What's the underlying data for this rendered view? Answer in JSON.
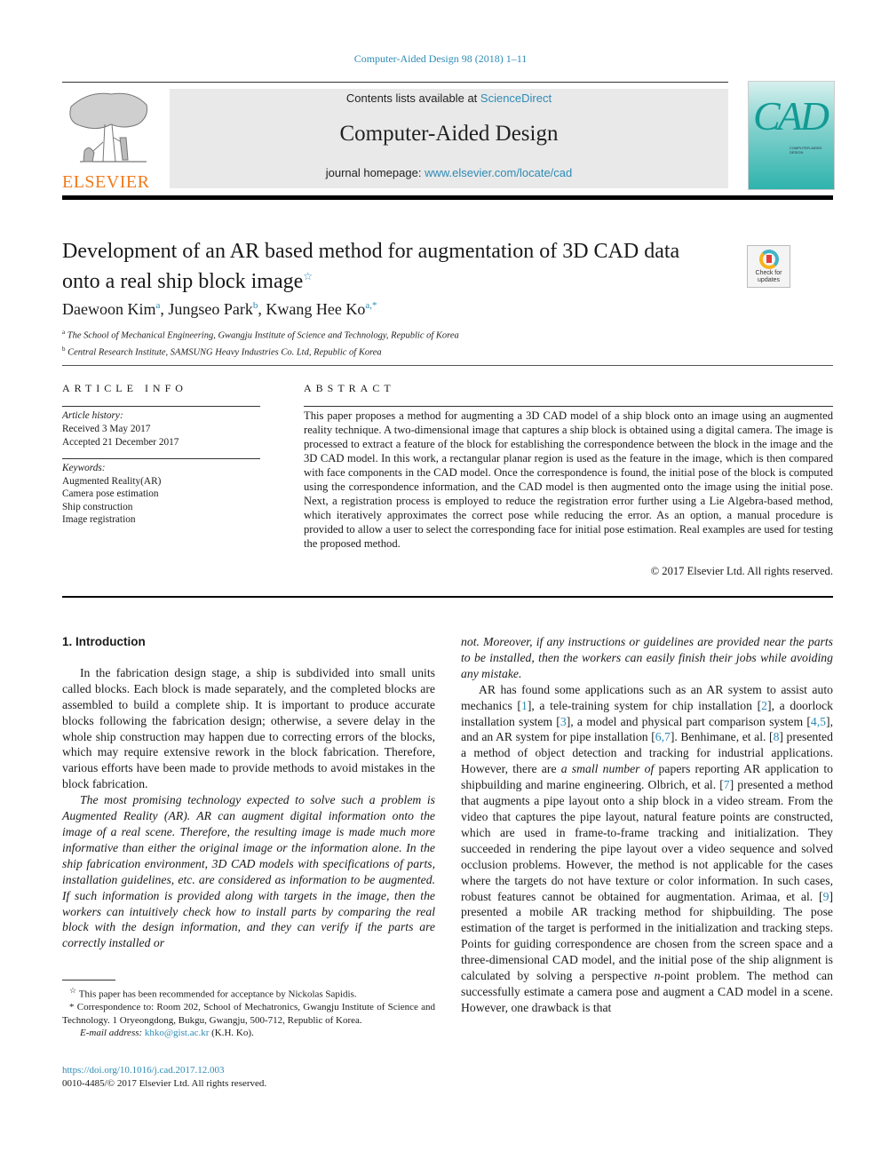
{
  "running_header": "Computer-Aided Design 98 (2018) 1–11",
  "masthead": {
    "publisher_logo": "ELSEVIER",
    "contents_prefix": "Contents lists available at ",
    "contents_link": "ScienceDirect",
    "journal_name": "Computer-Aided Design",
    "homepage_prefix": "journal homepage: ",
    "homepage_link": "www.elsevier.com/locate/cad",
    "cover_title": "CAD",
    "cover_subtitle": "COMPUTER-AIDED DESIGN"
  },
  "article": {
    "title": "Development of an AR based method for augmentation of 3D CAD data onto a real ship block image",
    "title_mark": "☆",
    "check_updates": "Check for updates",
    "authors": [
      {
        "name": "Daewoon Kim",
        "sup": "a",
        "sep": ", "
      },
      {
        "name": "Jungseo Park",
        "sup": "b",
        "sep": ", "
      },
      {
        "name": "Kwang Hee Ko",
        "sup": "a,*",
        "sep": ""
      }
    ],
    "affiliations": [
      {
        "sup": "a",
        "text": "The School of Mechanical Engineering, Gwangju Institute of Science and Technology, Republic of Korea"
      },
      {
        "sup": "b",
        "text": "Central Research Institute, SAMSUNG Heavy Industries Co. Ltd, Republic of Korea"
      }
    ]
  },
  "article_info": {
    "heading": "ARTICLE INFO",
    "history_label": "Article history:",
    "received": "Received 3 May 2017",
    "accepted": "Accepted 21 December 2017",
    "keywords_label": "Keywords:",
    "keywords": [
      "Augmented Reality(AR)",
      "Camera pose estimation",
      "Ship construction",
      "Image registration"
    ]
  },
  "abstract": {
    "heading": "ABSTRACT",
    "text": "This paper proposes a method for augmenting a 3D CAD model of a ship block onto an image using an augmented reality technique. A two-dimensional image that captures a ship block is obtained using a digital camera. The image is processed to extract a feature of the block for establishing the correspondence between the block in the image and the 3D CAD model. In this work, a rectangular planar region is used as the feature in the image, which is then compared with face components in the CAD model. Once the correspondence is found, the initial pose of the block is computed using the correspondence information, and the CAD model is then augmented onto the image using the initial pose. Next, a registration process is employed to reduce the registration error further using a Lie Algebra-based method, which iteratively approximates the correct pose while reducing the error. As an option, a manual procedure is provided to allow a user to select the corresponding face for initial pose estimation. Real examples are used for testing the proposed method.",
    "copyright": "© 2017 Elsevier Ltd. All rights reserved."
  },
  "body": {
    "section_heading": "1.  Introduction",
    "para1": "In the fabrication design stage, a ship is subdivided into small units called blocks. Each block is made separately, and the completed blocks are assembled to build a complete ship. It is important to produce accurate blocks following the fabrication design; otherwise, a severe delay in the whole ship construction may happen due to correcting errors of the blocks, which may require extensive rework in the block fabrication. Therefore, various efforts have been made to provide methods to avoid mistakes in the block fabrication.",
    "para2_left": "The most promising technology expected to solve such a problem is Augmented Reality (AR). AR can augment digital information onto the image of a real scene. Therefore, the resulting image is made much more informative than either the original image or the information alone. In the ship fabrication environment, 3D CAD models with specifications of parts, installation guidelines, etc. are considered as information to be augmented. If such information is provided along with targets in the image, then the workers can intuitively check how to install parts by comparing the real block with the design information, and they can verify if the parts are correctly installed or",
    "para2_right": "not. Moreover, if any instructions or guidelines are provided near the parts to be installed, then the workers can easily finish their jobs while avoiding any mistake.",
    "para3": [
      {
        "t": "AR has found some applications such as an AR system to assist auto mechanics ["
      },
      {
        "c": "1"
      },
      {
        "t": "], a tele-training system for chip installation ["
      },
      {
        "c": "2"
      },
      {
        "t": "], a doorlock installation system ["
      },
      {
        "c": "3"
      },
      {
        "t": "], a model and physical part comparison system ["
      },
      {
        "c": "4,5"
      },
      {
        "t": "], and an AR system for pipe installation ["
      },
      {
        "c": "6,7"
      },
      {
        "t": "]. Benhimane, et al. ["
      },
      {
        "c": "8"
      },
      {
        "t": "] presented a method of object detection and tracking for industrial applications. However, there are "
      },
      {
        "i": "a small number of"
      },
      {
        "t": " papers reporting AR application to shipbuilding and marine engineering. Olbrich, et al. ["
      },
      {
        "c": "7"
      },
      {
        "t": "] presented a method that augments a pipe layout onto a ship block in a video stream. From the video that captures the pipe layout, natural feature points are constructed, which are used in frame-to-frame tracking and initialization. They succeeded in rendering the pipe layout over a video sequence and solved occlusion problems. However, the method is not applicable for the cases where the targets do not have texture or color information. In such cases, robust features cannot be obtained for augmentation. Arimaa, et al. ["
      },
      {
        "c": "9"
      },
      {
        "t": "] presented a mobile AR tracking method for shipbuilding. The pose estimation of the target is performed in the initialization and tracking steps. Points for guiding correspondence are chosen from the screen space and a three-dimensional CAD model, and the initial pose of the ship alignment is calculated by solving a perspective "
      },
      {
        "i": "n"
      },
      {
        "t": "-point problem. The method can successfully estimate a camera pose and augment a CAD model in a scene. However, one drawback is that"
      }
    ]
  },
  "footnotes": {
    "star_mark": "☆",
    "star_text": "This paper has been recommended for acceptance by Nickolas Sapidis.",
    "corr_mark": "*",
    "corr_text": "Correspondence to: Room 202, School of Mechatronics, Gwangju Institute of Science and Technology. 1 Oryeongdong, Bukgu, Gwangju, 500-712, Republic of Korea.",
    "email_label": "E-mail address:",
    "email": "khko@gist.ac.kr",
    "email_suffix": " (K.H. Ko).",
    "doi": "https://doi.org/10.1016/j.cad.2017.12.003",
    "issn": "0010-4485/© 2017 Elsevier Ltd. All rights reserved."
  },
  "colors": {
    "link": "#2e8bb5",
    "elsevier_orange": "#f07a1a",
    "banner_gray": "#e9e9e9",
    "cover_teal": "#2fb3ad"
  }
}
